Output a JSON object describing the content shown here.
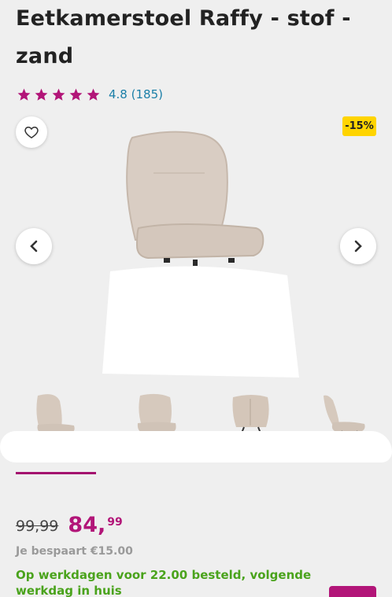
{
  "product": {
    "title": "Eetkamerstoel Raffy - stof - zand",
    "rating_value": "4.8",
    "review_count": "(185)",
    "rating_stars": 5,
    "discount_badge": "-15%"
  },
  "pricing": {
    "old_price": "99,99",
    "new_price_main": "84,",
    "new_price_cents": "99",
    "savings_text": "Je bespaart €15.00"
  },
  "delivery": {
    "text": "Op werkdagen voor 22.00 besteld, volgende werkdag in huis"
  },
  "colors": {
    "accent": "#b21578",
    "star": "#b21578",
    "rating_text": "#1b7fa8",
    "badge": "#ffd400",
    "delivery": "#4aa31c"
  },
  "icons": {
    "favorite": "heart-outline-icon",
    "prev": "chevron-left-icon",
    "next": "chevron-right-icon",
    "star": "star-icon"
  }
}
